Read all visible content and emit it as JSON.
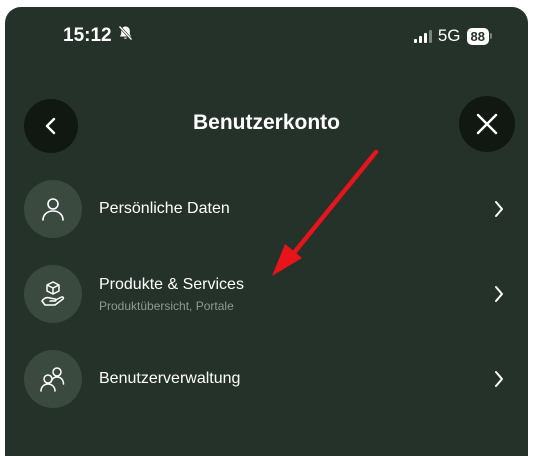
{
  "status_bar": {
    "time": "15:12",
    "network": "5G",
    "battery": "88"
  },
  "header": {
    "title": "Benutzerkonto"
  },
  "menu": {
    "items": [
      {
        "label": "Persönliche Daten",
        "sublabel": ""
      },
      {
        "label": "Produkte & Services",
        "sublabel": "Produktübersicht, Portale"
      },
      {
        "label": "Benutzerverwaltung",
        "sublabel": ""
      }
    ]
  },
  "colors": {
    "background": "#253229",
    "icon_circle": "#3a4a3f",
    "nav_button": "#111812",
    "annotation_arrow": "#e8141c"
  }
}
